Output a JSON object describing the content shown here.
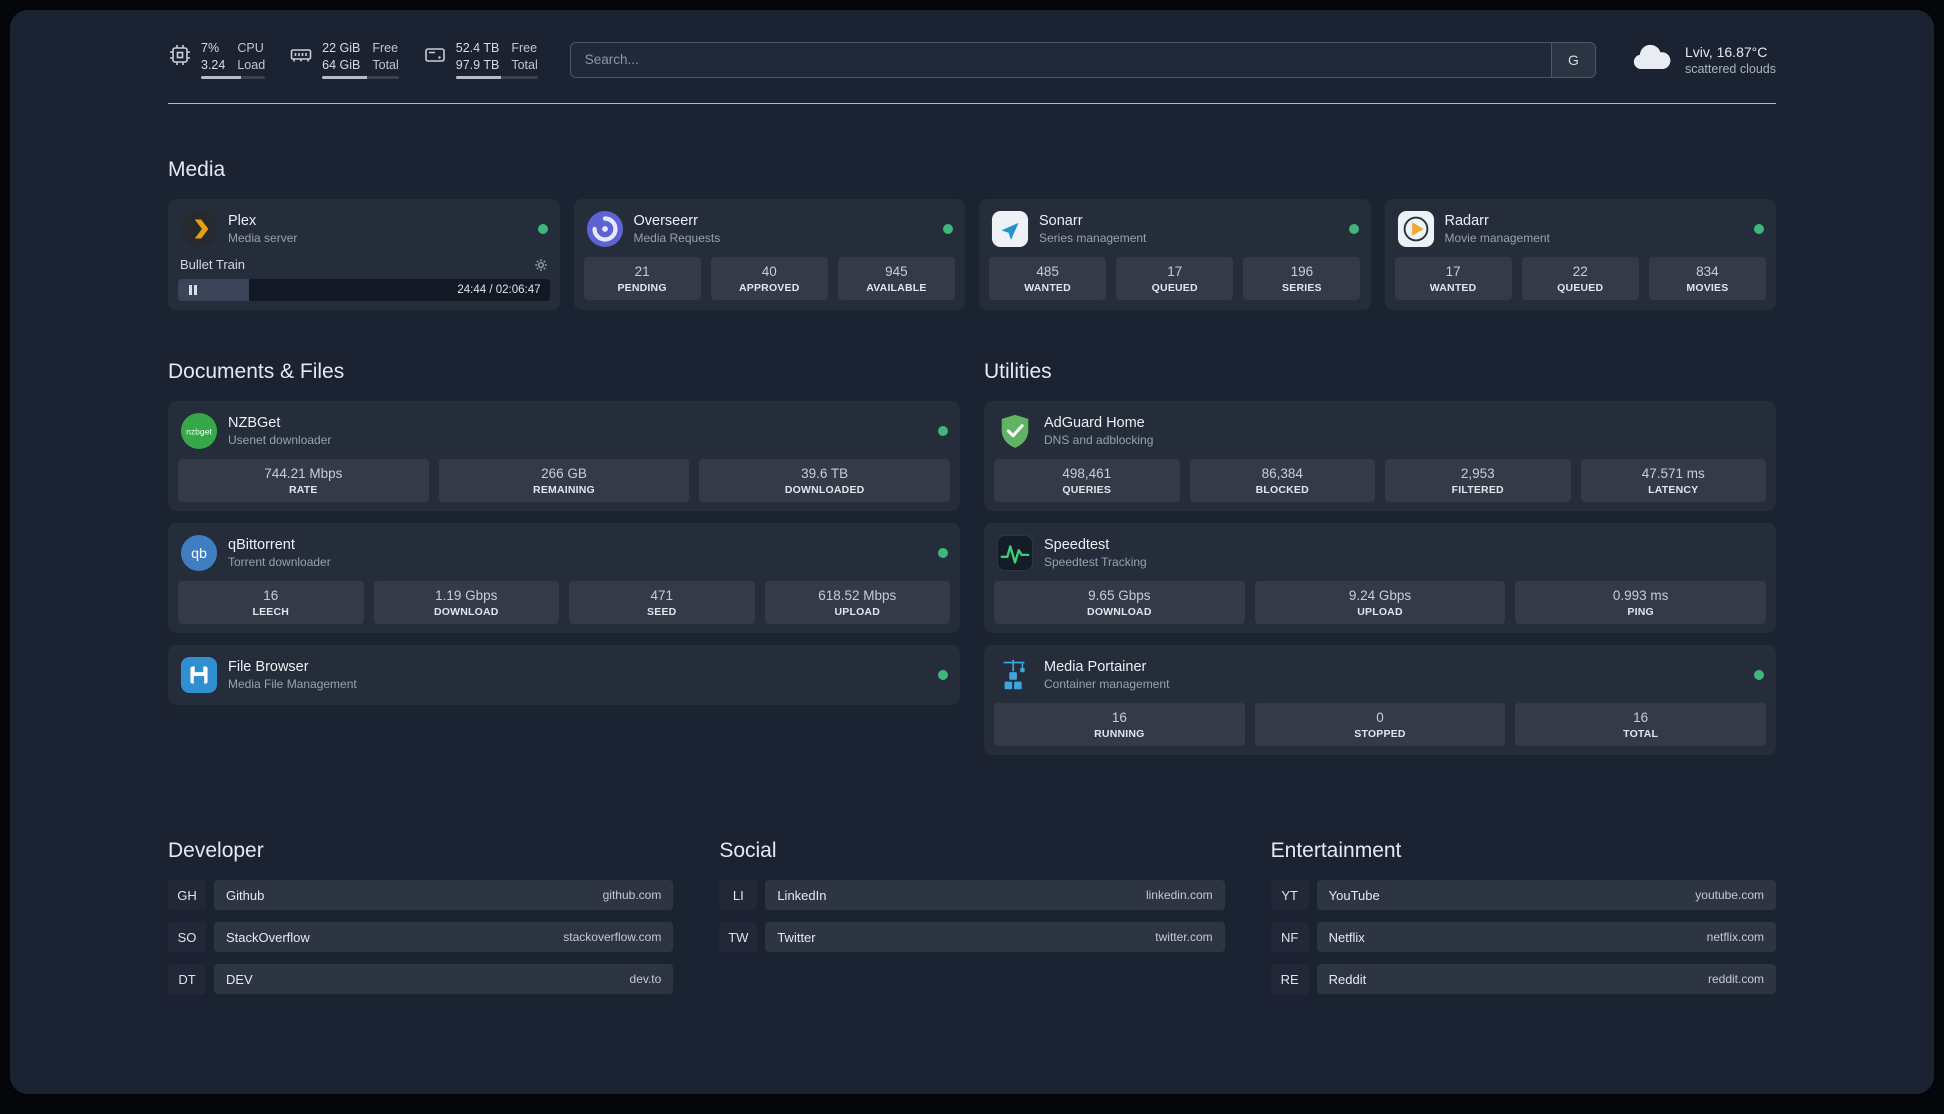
{
  "theme": {
    "status_online": "#3db77b",
    "background": "#1b2231",
    "plex_accent": "#e5a00d"
  },
  "topbar": {
    "resources": [
      {
        "icon": "cpu-icon",
        "line1": "7%",
        "line2": "3.24",
        "label1": "CPU",
        "label2": "Load",
        "fill_pct": 62
      },
      {
        "icon": "memory-icon",
        "line1": "22 GiB",
        "line2": "64 GiB",
        "label1": "Free",
        "label2": "Total",
        "fill_pct": 58
      },
      {
        "icon": "disk-icon",
        "line1": "52.4 TB",
        "line2": "97.9 TB",
        "label1": "Free",
        "label2": "Total",
        "fill_pct": 55
      }
    ],
    "search": {
      "placeholder": "Search...",
      "provider": "G"
    },
    "weather": {
      "location": "Lviv, 16.87°C",
      "condition": "scattered clouds"
    }
  },
  "sections": {
    "media": {
      "title": "Media",
      "services": [
        {
          "name": "Plex",
          "description": "Media server",
          "icon": "plex-icon",
          "status": "online",
          "player": {
            "title": "Bullet Train",
            "time": "24:44 / 02:06:47",
            "progress_pct": 19
          }
        },
        {
          "name": "Overseerr",
          "description": "Media Requests",
          "icon": "overseerr-icon",
          "status": "online",
          "stats": [
            {
              "value": "21",
              "label": "PENDING"
            },
            {
              "value": "40",
              "label": "APPROVED"
            },
            {
              "value": "945",
              "label": "AVAILABLE"
            }
          ]
        },
        {
          "name": "Sonarr",
          "description": "Series management",
          "icon": "sonarr-icon",
          "status": "online",
          "stats": [
            {
              "value": "485",
              "label": "WANTED"
            },
            {
              "value": "17",
              "label": "QUEUED"
            },
            {
              "value": "196",
              "label": "SERIES"
            }
          ]
        },
        {
          "name": "Radarr",
          "description": "Movie management",
          "icon": "radarr-icon",
          "status": "online",
          "stats": [
            {
              "value": "17",
              "label": "WANTED"
            },
            {
              "value": "22",
              "label": "QUEUED"
            },
            {
              "value": "834",
              "label": "MOVIES"
            }
          ]
        }
      ]
    },
    "documents": {
      "title": "Documents & Files",
      "services": [
        {
          "name": "NZBGet",
          "description": "Usenet downloader",
          "icon": "nzbget-icon",
          "status": "online",
          "stats": [
            {
              "value": "744.21 Mbps",
              "label": "RATE"
            },
            {
              "value": "266 GB",
              "label": "REMAINING"
            },
            {
              "value": "39.6 TB",
              "label": "DOWNLOADED"
            }
          ]
        },
        {
          "name": "qBittorrent",
          "description": "Torrent downloader",
          "icon": "qbittorrent-icon",
          "status": "online",
          "stats": [
            {
              "value": "16",
              "label": "LEECH"
            },
            {
              "value": "1.19 Gbps",
              "label": "DOWNLOAD"
            },
            {
              "value": "471",
              "label": "SEED"
            },
            {
              "value": "618.52 Mbps",
              "label": "UPLOAD"
            }
          ]
        },
        {
          "name": "File Browser",
          "description": "Media File Management",
          "icon": "filebrowser-icon",
          "status": "online"
        }
      ]
    },
    "utilities": {
      "title": "Utilities",
      "services": [
        {
          "name": "AdGuard Home",
          "description": "DNS and adblocking",
          "icon": "adguard-icon",
          "stats": [
            {
              "value": "498,461",
              "label": "QUERIES"
            },
            {
              "value": "86,384",
              "label": "BLOCKED"
            },
            {
              "value": "2,953",
              "label": "FILTERED"
            },
            {
              "value": "47.571 ms",
              "label": "LATENCY"
            }
          ]
        },
        {
          "name": "Speedtest",
          "description": "Speedtest Tracking",
          "icon": "speedtest-icon",
          "stats": [
            {
              "value": "9.65 Gbps",
              "label": "DOWNLOAD"
            },
            {
              "value": "9.24 Gbps",
              "label": "UPLOAD"
            },
            {
              "value": "0.993 ms",
              "label": "PING"
            }
          ]
        },
        {
          "name": "Media Portainer",
          "description": "Container management",
          "icon": "portainer-icon",
          "status": "online",
          "stats": [
            {
              "value": "16",
              "label": "RUNNING"
            },
            {
              "value": "0",
              "label": "STOPPED"
            },
            {
              "value": "16",
              "label": "TOTAL"
            }
          ]
        }
      ]
    },
    "bookmarks": [
      {
        "title": "Developer",
        "links": [
          {
            "abbr": "GH",
            "name": "Github",
            "domain": "github.com"
          },
          {
            "abbr": "SO",
            "name": "StackOverflow",
            "domain": "stackoverflow.com"
          },
          {
            "abbr": "DT",
            "name": "DEV",
            "domain": "dev.to"
          }
        ]
      },
      {
        "title": "Social",
        "links": [
          {
            "abbr": "LI",
            "name": "LinkedIn",
            "domain": "linkedin.com"
          },
          {
            "abbr": "TW",
            "name": "Twitter",
            "domain": "twitter.com"
          }
        ]
      },
      {
        "title": "Entertainment",
        "links": [
          {
            "abbr": "YT",
            "name": "YouTube",
            "domain": "youtube.com"
          },
          {
            "abbr": "NF",
            "name": "Netflix",
            "domain": "netflix.com"
          },
          {
            "abbr": "RE",
            "name": "Reddit",
            "domain": "reddit.com"
          }
        ]
      }
    ]
  }
}
